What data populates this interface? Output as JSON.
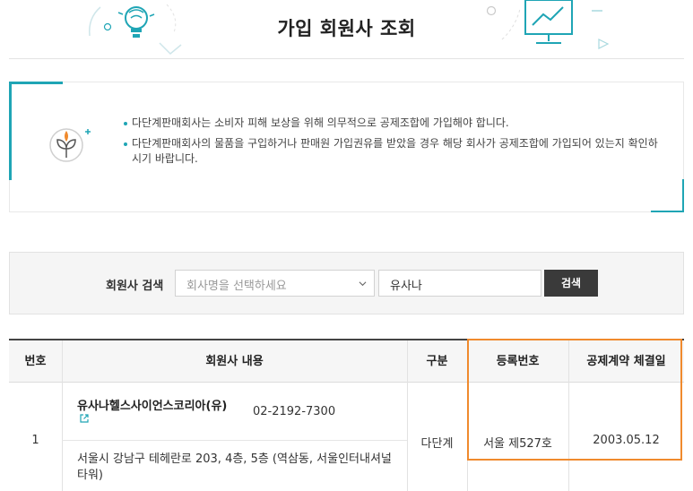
{
  "header": {
    "title": "가입 회원사 조회"
  },
  "notice": {
    "items": [
      "다단계판매회사는 소비자 피해 보상을 위해 의무적으로 공제조합에 가입해야 합니다.",
      "다단계판매회사의 물품을 구입하거나 판매원 가입권유를 받았을 경우 해당 회사가 공제조합에 가입되어 있는지 확인하시기 바랍니다."
    ]
  },
  "search": {
    "label": "회원사 검색",
    "select_placeholder": "회사명을 선택하세요",
    "input_value": "유사나",
    "button_label": "검색"
  },
  "table": {
    "headers": [
      "번호",
      "회원사 내용",
      "구분",
      "등록번호",
      "공제계약 체결일"
    ],
    "rows": [
      {
        "no": "1",
        "company": "유사나헬스사이언스코리아(유)",
        "phone": "02-2192-7300",
        "address": "서울시 강남구 테헤란로 203, 4층, 5층 (역삼동, 서울인터내셔널타워)",
        "type": "다단계",
        "reg_no": "서울 제527호",
        "contract_date": "2003.05.12"
      }
    ]
  },
  "colors": {
    "accent": "#1fa5b5",
    "highlight": "#f08a2d",
    "button": "#3a3a3a"
  }
}
